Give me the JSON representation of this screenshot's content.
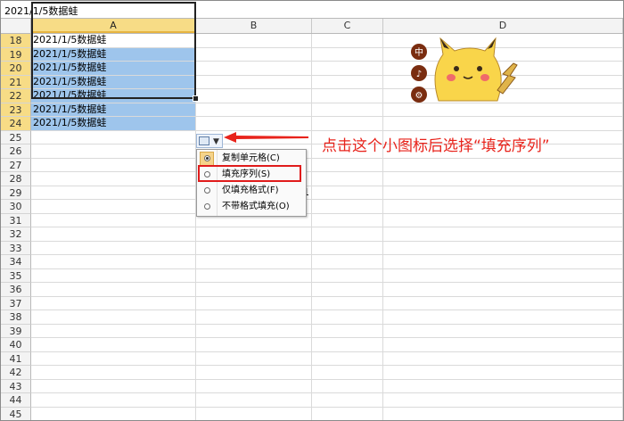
{
  "formula_bar": {
    "value": "2021/1/5数据蛙"
  },
  "columns": [
    "A",
    "B",
    "C",
    "D"
  ],
  "selected_column": "A",
  "rows": [
    {
      "num": "18",
      "a": "2021/1/5数据蛙",
      "sel": true,
      "hl": false
    },
    {
      "num": "19",
      "a": "2021/1/5数据蛙",
      "sel": true,
      "hl": true
    },
    {
      "num": "20",
      "a": "2021/1/5数据蛙",
      "sel": true,
      "hl": true
    },
    {
      "num": "21",
      "a": "2021/1/5数据蛙",
      "sel": true,
      "hl": true
    },
    {
      "num": "22",
      "a": "2021/1/5数据蛙",
      "sel": true,
      "hl": true
    },
    {
      "num": "23",
      "a": "2021/1/5数据蛙",
      "sel": true,
      "hl": true
    },
    {
      "num": "24",
      "a": "2021/1/5数据蛙",
      "sel": true,
      "hl": true
    },
    {
      "num": "25",
      "a": ""
    },
    {
      "num": "26",
      "a": ""
    },
    {
      "num": "27",
      "a": ""
    },
    {
      "num": "28",
      "a": ""
    },
    {
      "num": "29",
      "a": "",
      "b": "1"
    },
    {
      "num": "30",
      "a": ""
    },
    {
      "num": "31",
      "a": ""
    },
    {
      "num": "32",
      "a": ""
    },
    {
      "num": "33",
      "a": ""
    },
    {
      "num": "34",
      "a": ""
    },
    {
      "num": "35",
      "a": ""
    },
    {
      "num": "36",
      "a": ""
    },
    {
      "num": "37",
      "a": ""
    },
    {
      "num": "38",
      "a": ""
    },
    {
      "num": "39",
      "a": ""
    },
    {
      "num": "40",
      "a": ""
    },
    {
      "num": "41",
      "a": ""
    },
    {
      "num": "42",
      "a": ""
    },
    {
      "num": "43",
      "a": ""
    },
    {
      "num": "44",
      "a": ""
    },
    {
      "num": "45",
      "a": ""
    }
  ],
  "autofill_menu": {
    "items": [
      {
        "label": "复制单元格(C)",
        "selected": true
      },
      {
        "label": "填充序列(S)",
        "selected": false
      },
      {
        "label": "仅填充格式(F)",
        "selected": false
      },
      {
        "label": "不带格式填充(O)",
        "selected": false
      }
    ]
  },
  "annotation": {
    "text": "点击这个小图标后选择“填充序列”",
    "color": "#e8231b"
  },
  "mascot": {
    "badge_chars": [
      "中",
      "♪",
      "⚙"
    ],
    "color": "#f9d54a"
  }
}
